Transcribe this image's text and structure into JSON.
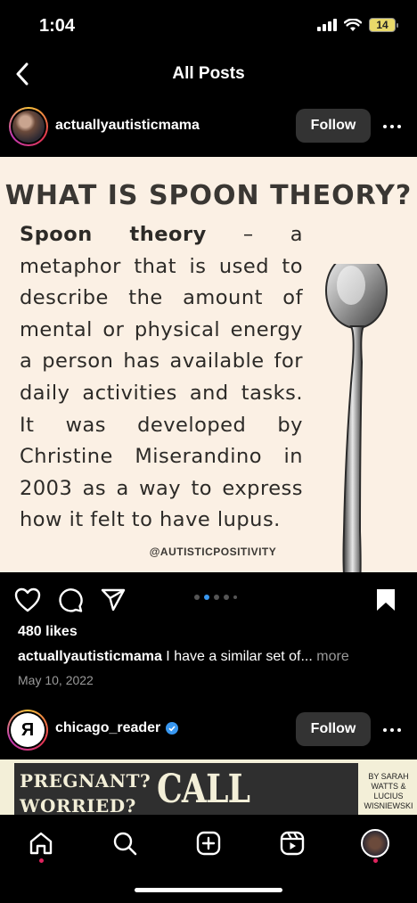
{
  "status_bar": {
    "time": "1:04",
    "battery": "14"
  },
  "nav": {
    "title": "All Posts"
  },
  "post1": {
    "username": "actuallyautisticmama",
    "follow_label": "Follow",
    "image": {
      "title": "WHAT IS SPOON THEORY?",
      "body_bold": "Spoon theory",
      "body_text": " – a metaphor that is used to describe the amount of mental or physical energy a person has available for daily activities and tasks. It was developed by Christine Miserandino in 2003 as a way to express how it felt to have lupus.",
      "credit": "@AUTISTICPOSITIVITY"
    },
    "likes": "480 likes",
    "caption_user": "actuallyautisticmama",
    "caption_text": " I have a similar set of...",
    "caption_more": " more",
    "date": "May 10, 2022"
  },
  "post2": {
    "username": "chicago_reader",
    "avatar_letter": "R",
    "follow_label": "Follow",
    "banner_line1": "PREGNANT?",
    "banner_line2": "WORRIED?",
    "banner_big": "CALL JANE",
    "byline": "BY SARAH WATTS & LUCIUS WISNIEWSKI"
  },
  "colors": {
    "accent": "#3897f0",
    "notification": "#e0245e",
    "image_bg": "#fbf0e4"
  },
  "icons": [
    "back-chevron-icon",
    "heart-icon",
    "comment-icon",
    "share-icon",
    "bookmark-icon",
    "more-icon",
    "verified-icon",
    "home-icon",
    "search-icon",
    "create-icon",
    "reels-icon",
    "profile-icon"
  ]
}
